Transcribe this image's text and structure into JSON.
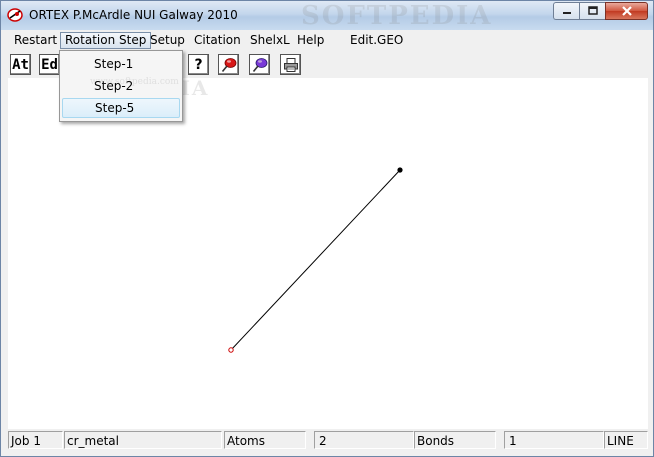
{
  "window": {
    "title": "ORTEX  P.McArdle NUI Galway 2010",
    "icon": "ortex-app-icon"
  },
  "menu": {
    "items": [
      {
        "label": "Restart"
      },
      {
        "label": "Rotation Step",
        "active": true
      },
      {
        "label": "Setup"
      },
      {
        "label": "Citation"
      },
      {
        "label": "ShelxL"
      },
      {
        "label": "Help"
      },
      {
        "label": "Edit.GEO"
      }
    ]
  },
  "toolbar": {
    "at_label": "At",
    "ed_label": "Ed",
    "help_label": "?",
    "icons": [
      "red-pin-icon",
      "blue-pin-icon",
      "printer-icon"
    ]
  },
  "rotation_step_menu": {
    "items": [
      {
        "label": "Step-1"
      },
      {
        "label": "Step-2"
      },
      {
        "label": "Step-5",
        "hover": true
      }
    ]
  },
  "watermark": {
    "brand": "SOFTPEDIA",
    "url": "www.softpedia.com"
  },
  "status": {
    "job": "Job 1",
    "name": "cr_metal",
    "atoms_label": "Atoms",
    "atoms_count": "2",
    "bonds_label": "Bonds",
    "bonds_count": "1",
    "mode": "LINE"
  },
  "colors": {
    "accent": "#c13a22",
    "atom_black": "#000000",
    "atom_red": "#cc0000"
  }
}
